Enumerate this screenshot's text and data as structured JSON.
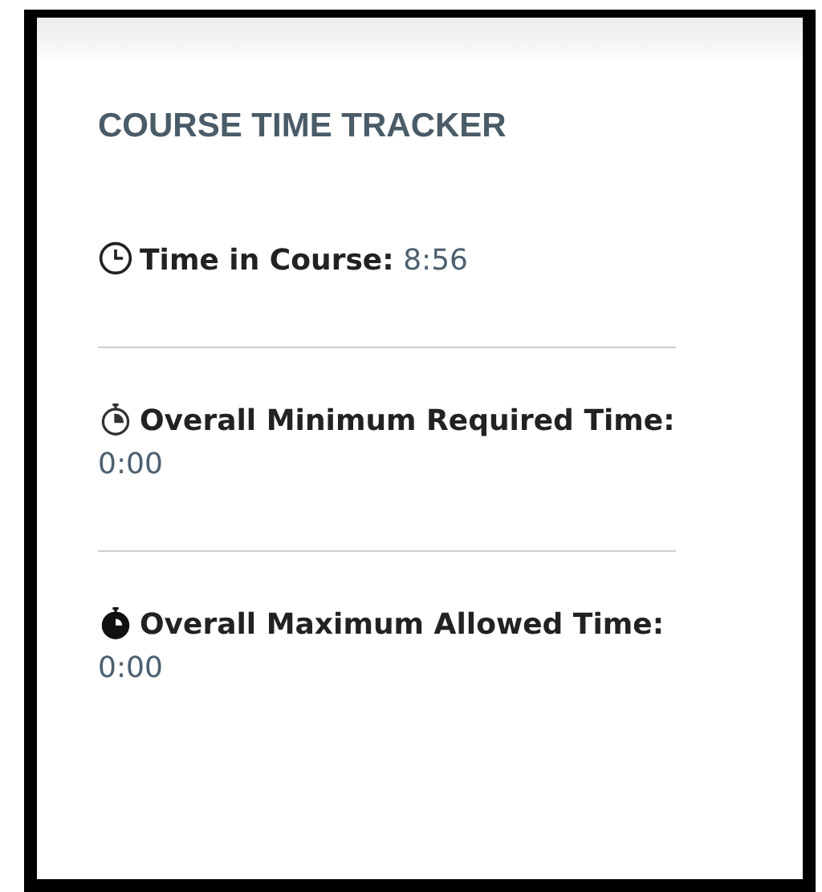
{
  "title": "COURSE TIME TRACKER",
  "stats": [
    {
      "kind": "clock",
      "label": "Time in Course:",
      "value": "8:56"
    },
    {
      "kind": "stopwatch-outline",
      "label": "Overall Minimum Required Time:",
      "value": "0:00"
    },
    {
      "kind": "stopwatch-filled",
      "label": "Overall Maximum Allowed Time:",
      "value": "0:00"
    }
  ]
}
